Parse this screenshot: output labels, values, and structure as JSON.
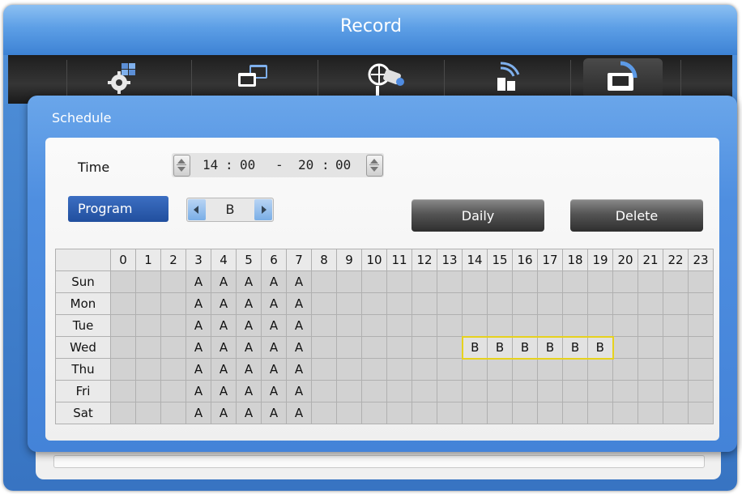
{
  "window": {
    "title": "Record"
  },
  "tabs": [
    {
      "icon": "grid-gear-icon"
    },
    {
      "icon": "windows-icon"
    },
    {
      "icon": "camera-network-icon"
    },
    {
      "icon": "signal-icon"
    },
    {
      "icon": "record-tape-icon",
      "active": true
    }
  ],
  "dialog": {
    "title": "Schedule",
    "time_label": "Time",
    "time": {
      "start_h": "14",
      "start_m": "00",
      "end_h": "20",
      "end_m": "00",
      "colon": ":",
      "dash": "-"
    },
    "program_button": "Program",
    "program_value": "B",
    "daily_button": "Daily",
    "delete_button": "Delete"
  },
  "schedule": {
    "hours": [
      "0",
      "1",
      "2",
      "3",
      "4",
      "5",
      "6",
      "7",
      "8",
      "9",
      "10",
      "11",
      "12",
      "13",
      "14",
      "15",
      "16",
      "17",
      "18",
      "19",
      "20",
      "21",
      "22",
      "23"
    ],
    "days": [
      {
        "name": "Sun",
        "cells": [
          "",
          "",
          "",
          "A",
          "A",
          "A",
          "A",
          "A",
          "",
          "",
          "",
          "",
          "",
          "",
          "",
          "",
          "",
          "",
          "",
          "",
          "",
          "",
          "",
          ""
        ]
      },
      {
        "name": "Mon",
        "cells": [
          "",
          "",
          "",
          "A",
          "A",
          "A",
          "A",
          "A",
          "",
          "",
          "",
          "",
          "",
          "",
          "",
          "",
          "",
          "",
          "",
          "",
          "",
          "",
          "",
          ""
        ]
      },
      {
        "name": "Tue",
        "cells": [
          "",
          "",
          "",
          "A",
          "A",
          "A",
          "A",
          "A",
          "",
          "",
          "",
          "",
          "",
          "",
          "",
          "",
          "",
          "",
          "",
          "",
          "",
          "",
          "",
          ""
        ]
      },
      {
        "name": "Wed",
        "cells": [
          "",
          "",
          "",
          "A",
          "A",
          "A",
          "A",
          "A",
          "",
          "",
          "",
          "",
          "",
          "",
          "B",
          "B",
          "B",
          "B",
          "B",
          "B",
          "",
          "",
          "",
          ""
        ]
      },
      {
        "name": "Thu",
        "cells": [
          "",
          "",
          "",
          "A",
          "A",
          "A",
          "A",
          "A",
          "",
          "",
          "",
          "",
          "",
          "",
          "",
          "",
          "",
          "",
          "",
          "",
          "",
          "",
          "",
          ""
        ]
      },
      {
        "name": "Fri",
        "cells": [
          "",
          "",
          "",
          "A",
          "A",
          "A",
          "A",
          "A",
          "",
          "",
          "",
          "",
          "",
          "",
          "",
          "",
          "",
          "",
          "",
          "",
          "",
          "",
          "",
          ""
        ]
      },
      {
        "name": "Sat",
        "cells": [
          "",
          "",
          "",
          "A",
          "A",
          "A",
          "A",
          "A",
          "",
          "",
          "",
          "",
          "",
          "",
          "",
          "",
          "",
          "",
          "",
          "",
          "",
          "",
          "",
          ""
        ]
      }
    ],
    "highlight_color": "#e6d21e"
  }
}
